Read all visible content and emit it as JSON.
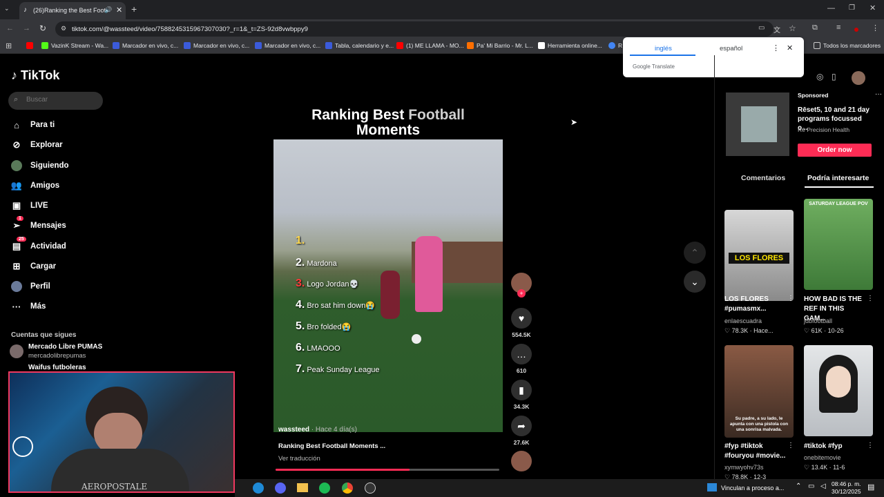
{
  "browser": {
    "tab_title": "(26)Ranking the Best Football",
    "url": "tiktok.com/@wassteed/video/7588245315967307030?_r=1&_t=ZS-92d8vwbppy9",
    "bookmarks": [
      {
        "label": "",
        "color": "#ff0000"
      },
      {
        "label": "VazinK Stream - Wa...",
        "color": "#53fc18"
      },
      {
        "label": "Marcador en vivo, c...",
        "color": "#3b5bdb"
      },
      {
        "label": "Marcador en vivo, c...",
        "color": "#3b5bdb"
      },
      {
        "label": "Marcador en vivo, c...",
        "color": "#3b5bdb"
      },
      {
        "label": "Tabla, calendario y e...",
        "color": "#3b5bdb"
      },
      {
        "label": "(1) ME LLAMA - MO...",
        "color": "#ff0000"
      },
      {
        "label": "Pa' Mi Barrio - Mr. L...",
        "color": "#ff6f00"
      },
      {
        "label": "Herramienta online...",
        "color": "#ffffff"
      },
      {
        "label": "R",
        "color": "#4285f4"
      }
    ],
    "all_bookmarks": "Todos los marcadores"
  },
  "translate_popup": {
    "lang_from": "inglés",
    "lang_to": "español",
    "brand": "Google Translate"
  },
  "tiktok": {
    "logo": "TikTok",
    "search_placeholder": "Buscar",
    "nav": [
      {
        "label": "Para ti",
        "icon": "home-icon",
        "badge": ""
      },
      {
        "label": "Explorar",
        "icon": "compass-icon",
        "badge": ""
      },
      {
        "label": "Siguiendo",
        "icon": "avatar-icon",
        "badge": ""
      },
      {
        "label": "Amigos",
        "icon": "people-icon",
        "badge": ""
      },
      {
        "label": "LIVE",
        "icon": "live-icon",
        "badge": ""
      },
      {
        "label": "Mensajes",
        "icon": "send-icon",
        "badge": "1"
      },
      {
        "label": "Actividad",
        "icon": "inbox-icon",
        "badge": "25"
      },
      {
        "label": "Cargar",
        "icon": "upload-icon",
        "badge": ""
      },
      {
        "label": "Perfil",
        "icon": "profile-icon",
        "badge": ""
      },
      {
        "label": "Más",
        "icon": "more-icon",
        "badge": ""
      }
    ],
    "following_title": "Cuentas que sigues",
    "following": [
      {
        "name": "Mercado Libre PUMAS",
        "handle": "mercadolibrepumas"
      },
      {
        "name": "Waifus futboleras",
        "handle": ""
      }
    ]
  },
  "video": {
    "title_white": "Ranking Best",
    "title_grey": "Football",
    "title_line2": "Moments",
    "ranks": [
      {
        "n": "1.",
        "text": "",
        "color": "#ffd84d"
      },
      {
        "n": "2.",
        "text": "Mardona",
        "color": "#ffffff"
      },
      {
        "n": "3.",
        "text": "Logo Jordan💀",
        "color": "#ff3b3b"
      },
      {
        "n": "4.",
        "text": "Bro sat him down😭",
        "color": "#ffffff"
      },
      {
        "n": "5.",
        "text": "Bro folded😭",
        "color": "#ffffff"
      },
      {
        "n": "6.",
        "text": "LMAOOO",
        "color": "#ffffff"
      },
      {
        "n": "7.",
        "text": "Peak Sunday League",
        "color": "#ffffff"
      }
    ],
    "author": "wassteed",
    "posted": "· Hace 4 día(s)",
    "caption": "Ranking Best Football Moments ...",
    "translate_link": "Ver traducción",
    "progress": 0.6
  },
  "actions": {
    "likes": "554.5K",
    "comments": "610",
    "saves": "34.3K",
    "shares": "27.6K"
  },
  "right_panel": {
    "ad": {
      "sponsored": "Sponsored",
      "title": "Rēset5, 10 and 21 day programs focussed o...",
      "brand": "Rē Precision Health",
      "cta": "Order now"
    },
    "tabs": [
      "Comentarios",
      "Podría interesarte"
    ],
    "cards": [
      {
        "title": "LOS FLORES #pumasmx...",
        "author": "enlaescuadra",
        "meta": "♡ 78.3K · Hace...",
        "overlay": "LOS FLORES",
        "bg": "#c9c9c9"
      },
      {
        "title": "HOW BAD IS THE REF IN THIS GAM...",
        "author": "jdbfootball",
        "meta": "♡ 61K · 10-26",
        "overlay": "SATURDAY LEAGUE POV",
        "bg": "#5e9b52"
      },
      {
        "title": "#fyp #tiktok #fouryou #movie...",
        "author": "xymwyohv73s",
        "meta": "♡ 78.8K · 12-3",
        "overlay": "Su padre, a su lado, le apunta con una pistola con una sonrisa malvada.",
        "bg": "#6b4a3a"
      },
      {
        "title": "#tiktok #fyp",
        "author": "onebitemovie",
        "meta": "♡ 13.4K · 11-6",
        "overlay": "",
        "bg": "#d4d8dc"
      }
    ]
  },
  "taskbar": {
    "notification": "Vinculan a proceso a...",
    "time": "08:46 p. m.",
    "date": "30/12/2025"
  },
  "webcam": {
    "shirt_text": "AEROPOSTALE"
  }
}
